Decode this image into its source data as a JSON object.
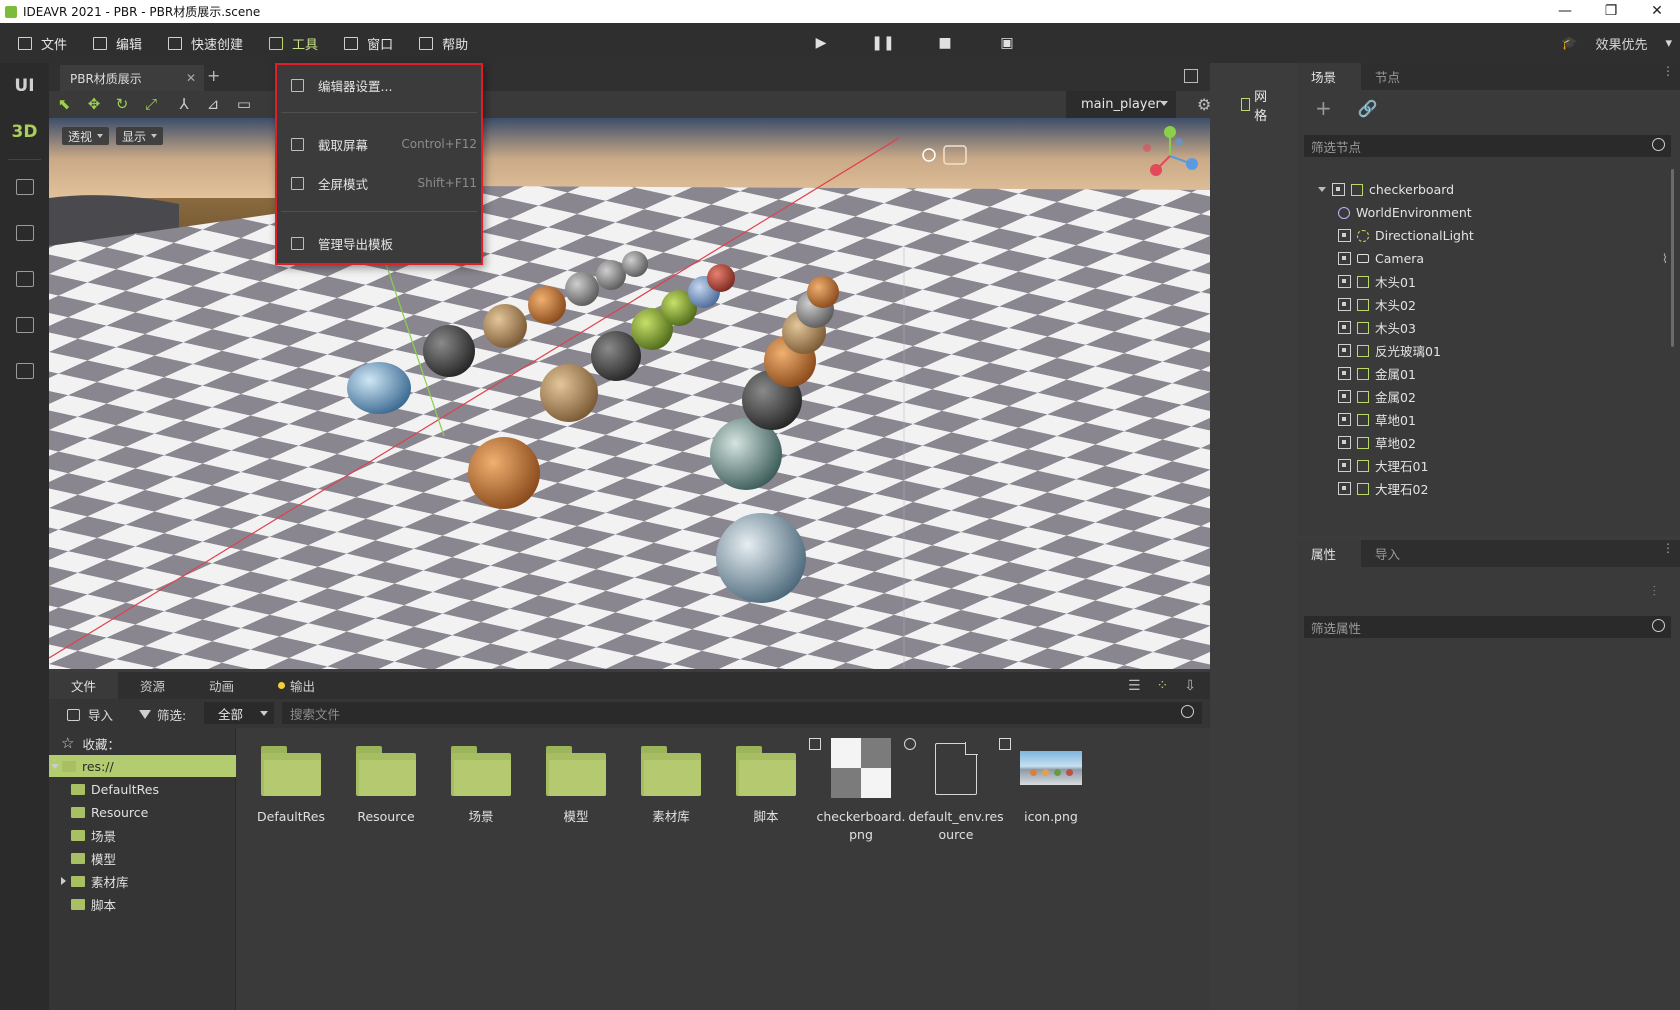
{
  "window": {
    "title": "IDEAVR 2021 - PBR - PBR材质展示.scene",
    "controls": [
      "—",
      "❐",
      "✕"
    ]
  },
  "menubar": {
    "items": [
      "文件",
      "编辑",
      "快速创建",
      "工具",
      "窗口",
      "帮助"
    ],
    "active_index": 3,
    "quality": "效果优先"
  },
  "leftrail": {
    "ui_label": "UI",
    "d3_label": "3D"
  },
  "editor": {
    "tab_label": "PBR材质展示",
    "player": "main_player",
    "grid_label": "网格",
    "view_mode": "透视",
    "display_mode": "显示"
  },
  "tools_menu": {
    "items": [
      {
        "label": "编辑器设置...",
        "shortcut": ""
      },
      {
        "label": "截取屏幕",
        "shortcut": "Control+F12"
      },
      {
        "label": "全屏模式",
        "shortcut": "Shift+F11"
      },
      {
        "label": "管理导出模板",
        "shortcut": ""
      }
    ]
  },
  "scene_panel": {
    "tabs": [
      "场景",
      "节点"
    ],
    "filter_placeholder": "筛选节点",
    "nodes": [
      {
        "name": "checkerboard",
        "icon": "mesh-icon",
        "root": true
      },
      {
        "name": "WorldEnvironment",
        "icon": "world-icon"
      },
      {
        "name": "DirectionalLight",
        "icon": "light-icon"
      },
      {
        "name": "Camera",
        "icon": "camera-icon"
      },
      {
        "name": "木头01",
        "icon": "mesh-icon"
      },
      {
        "name": "木头02",
        "icon": "mesh-icon"
      },
      {
        "name": "木头03",
        "icon": "mesh-icon"
      },
      {
        "name": "反光玻璃01",
        "icon": "mesh-icon"
      },
      {
        "name": "金属01",
        "icon": "mesh-icon"
      },
      {
        "name": "金属02",
        "icon": "mesh-icon"
      },
      {
        "name": "草地01",
        "icon": "mesh-icon"
      },
      {
        "name": "草地02",
        "icon": "mesh-icon"
      },
      {
        "name": "大理石01",
        "icon": "mesh-icon"
      },
      {
        "name": "大理石02",
        "icon": "mesh-icon"
      }
    ]
  },
  "inspector": {
    "tabs": [
      "属性",
      "导入"
    ],
    "filter_placeholder": "筛选属性"
  },
  "bottom_panel": {
    "tabs": [
      "文件",
      "资源",
      "动画",
      "输出"
    ],
    "import_label": "导入",
    "filter_label": "筛选:",
    "filter_value": "全部",
    "search_placeholder": "搜索文件",
    "favorites_label": "收藏：",
    "tree": [
      {
        "name": "res://",
        "level": 0,
        "selected": true
      },
      {
        "name": "DefaultRes",
        "level": 1
      },
      {
        "name": "Resource",
        "level": 1
      },
      {
        "name": "场景",
        "level": 1
      },
      {
        "name": "模型",
        "level": 1
      },
      {
        "name": "素材库",
        "level": 1,
        "collapsed": true
      },
      {
        "name": "脚本",
        "level": 1
      }
    ],
    "files": [
      {
        "name": "DefaultRes",
        "kind": "folder"
      },
      {
        "name": "Resource",
        "kind": "folder"
      },
      {
        "name": "场景",
        "kind": "folder"
      },
      {
        "name": "模型",
        "kind": "folder"
      },
      {
        "name": "素材库",
        "kind": "folder"
      },
      {
        "name": "脚本",
        "kind": "folder"
      },
      {
        "name": "checkerboard.png",
        "kind": "image"
      },
      {
        "name": "default_env.resource",
        "kind": "resource"
      },
      {
        "name": "icon.png",
        "kind": "image"
      }
    ]
  }
}
